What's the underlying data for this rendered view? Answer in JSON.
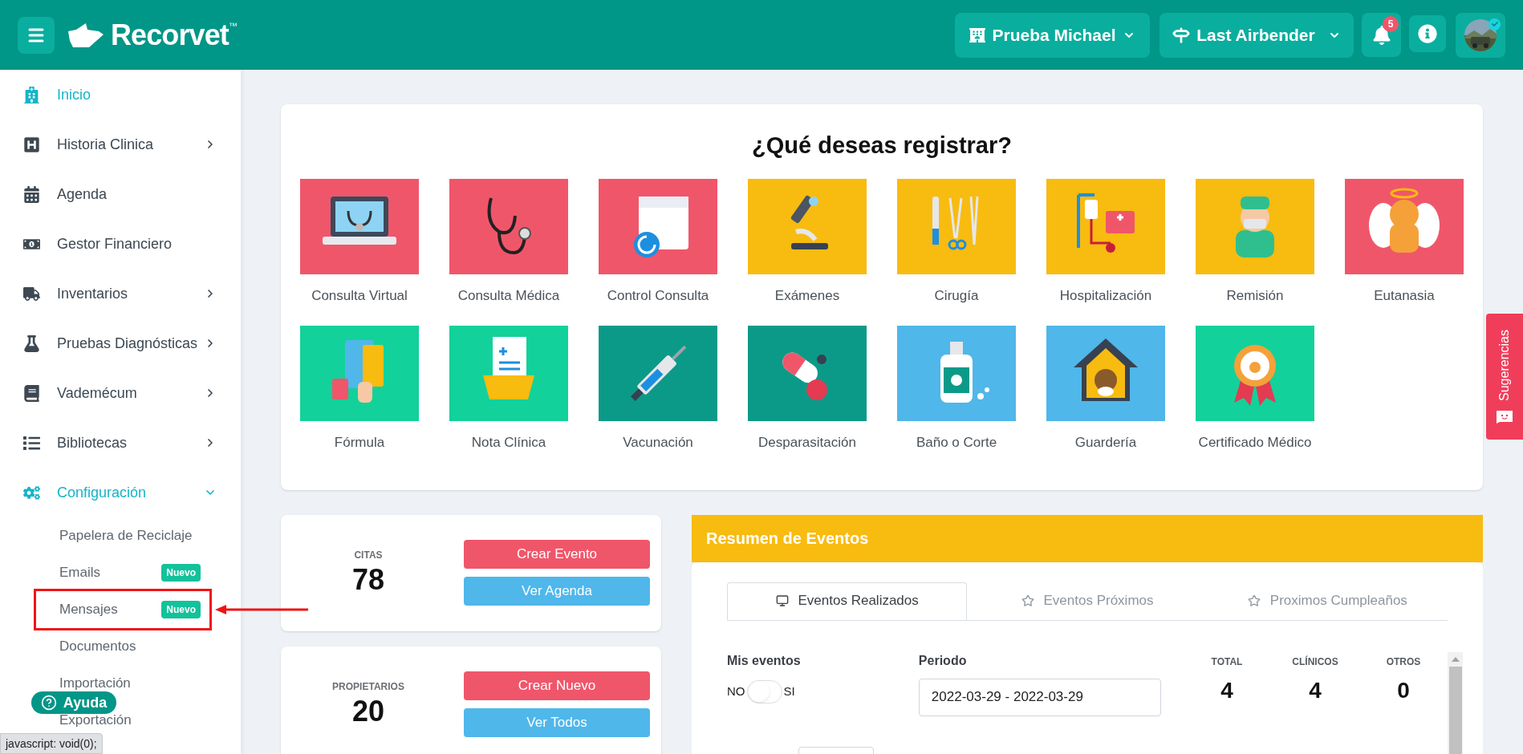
{
  "header": {
    "brand": "Recorvet",
    "trademark": "™",
    "clinic": "Prueba Michael",
    "branch": "Last Airbender",
    "notifications": "5",
    "verified": true
  },
  "sidebar": {
    "items": [
      {
        "label": "Inicio",
        "selected": true
      },
      {
        "label": "Historia Clinica",
        "selected": false,
        "expanded": false
      },
      {
        "label": "Agenda",
        "selected": false
      },
      {
        "label": "Gestor Financiero",
        "selected": false
      },
      {
        "label": "Inventarios",
        "selected": false,
        "expanded": false
      },
      {
        "label": "Pruebas Diagnósticas",
        "selected": false,
        "expanded": false
      },
      {
        "label": "Vademécum",
        "selected": false,
        "expanded": false
      },
      {
        "label": "Bibliotecas",
        "selected": false,
        "expanded": false
      },
      {
        "label": "Configuración",
        "selected": true,
        "expanded": true,
        "children": [
          {
            "label": "Papelera de Reciclaje",
            "highlighted": false
          },
          {
            "label": "Emails",
            "badge": "Nuevo",
            "highlighted": false
          },
          {
            "label": "Mensajes",
            "badge": "Nuevo",
            "highlighted": true
          },
          {
            "label": "Documentos",
            "highlighted": false
          },
          {
            "label": "Importación",
            "highlighted": false
          },
          {
            "label": "Exportación",
            "highlighted": false
          }
        ]
      }
    ]
  },
  "help_button": "Ayuda",
  "status_bar": "javascript: void(0);",
  "register": {
    "title": "¿Qué deseas registrar?",
    "options": [
      {
        "label": "Consulta Virtual",
        "color": "#f0566a"
      },
      {
        "label": "Consulta Médica",
        "color": "#f0566a"
      },
      {
        "label": "Control Consulta",
        "color": "#f0566a"
      },
      {
        "label": "Exámenes",
        "color": "#f8bb10"
      },
      {
        "label": "Cirugía",
        "color": "#f8bb10"
      },
      {
        "label": "Hospitalización",
        "color": "#f8bb10"
      },
      {
        "label": "Remisión",
        "color": "#f8bb10"
      },
      {
        "label": "Eutanasia",
        "color": "#f0566a"
      },
      {
        "label": "Fórmula",
        "color": "#13d19a"
      },
      {
        "label": "Nota Clínica",
        "color": "#13d19a"
      },
      {
        "label": "Vacunación",
        "color": "#0c9a88"
      },
      {
        "label": "Desparasitación",
        "color": "#0c9a88"
      },
      {
        "label": "Baño o Corte",
        "color": "#4fb7ea"
      },
      {
        "label": "Guardería",
        "color": "#4fb7ea"
      },
      {
        "label": "Certificado Médico",
        "color": "#13d19a"
      }
    ]
  },
  "stat_cards": [
    {
      "label": "CITAS",
      "value": "78",
      "primary_button": "Crear Evento",
      "secondary_button": "Ver Agenda"
    },
    {
      "label": "PROPIETARIOS",
      "value": "20",
      "primary_button": "Crear Nuevo",
      "secondary_button": "Ver Todos"
    }
  ],
  "events_summary": {
    "title": "Resumen de Eventos",
    "tabs": [
      {
        "label": "Eventos Realizados",
        "selected": true,
        "kind": "monitor"
      },
      {
        "label": "Eventos Próximos",
        "selected": false,
        "kind": "star"
      },
      {
        "label": "Proximos Cumpleaños",
        "selected": false,
        "kind": "star"
      }
    ],
    "my_events": {
      "label": "Mis eventos",
      "off_label": "NO",
      "on_label": "SI",
      "on": false
    },
    "period": {
      "label": "Periodo",
      "value": "2022-03-29 - 2022-03-29"
    },
    "totals": [
      {
        "label": "TOTAL",
        "value": "4"
      },
      {
        "label": "CLÍNICOS",
        "value": "4"
      },
      {
        "label": "OTROS",
        "value": "0"
      }
    ]
  },
  "feedback_tab": "Sugerencias"
}
